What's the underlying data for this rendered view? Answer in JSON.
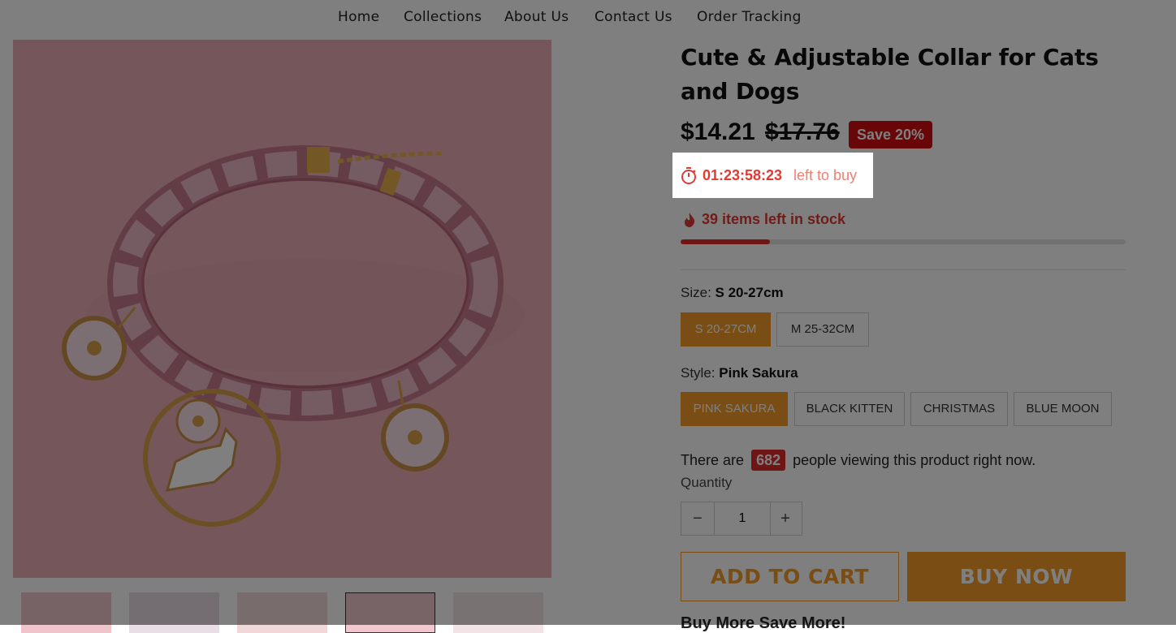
{
  "nav": {
    "items": [
      "Home",
      "Collections",
      "About Us",
      "Contact Us",
      "Order Tracking"
    ]
  },
  "product": {
    "title": "Cute & Adjustable Collar for Cats and Dogs",
    "price": "$14.21",
    "compare_price": "$17.76",
    "save_badge": "Save 20%"
  },
  "timer": {
    "value": "01:23:58:23",
    "label": "left to buy",
    "icon": "stopwatch-icon"
  },
  "stock": {
    "text": "39 items left in stock",
    "icon": "flame-icon",
    "fraction": 0.2
  },
  "size": {
    "label": "Size:",
    "selected": "S 20-27cm",
    "options": [
      "S 20-27CM",
      "M 25-32CM"
    ]
  },
  "style": {
    "label": "Style:",
    "selected": "Pink Sakura",
    "options": [
      "PINK SAKURA",
      "BLACK KITTEN",
      "CHRISTMAS",
      "BLUE MOON"
    ]
  },
  "viewers": {
    "prefix": "There are",
    "count": "682",
    "suffix": "people viewing this product right now."
  },
  "quantity": {
    "label": "Quantity",
    "value": "1",
    "minus": "−",
    "plus": "+"
  },
  "buttons": {
    "add_to_cart": "ADD TO CART",
    "buy_now": "BUY NOW"
  },
  "promo": {
    "heading": "Buy More Save More!"
  },
  "colors": {
    "accent": "#f29b28",
    "sale_red": "#d10d10",
    "timer_red": "#e03a33"
  }
}
